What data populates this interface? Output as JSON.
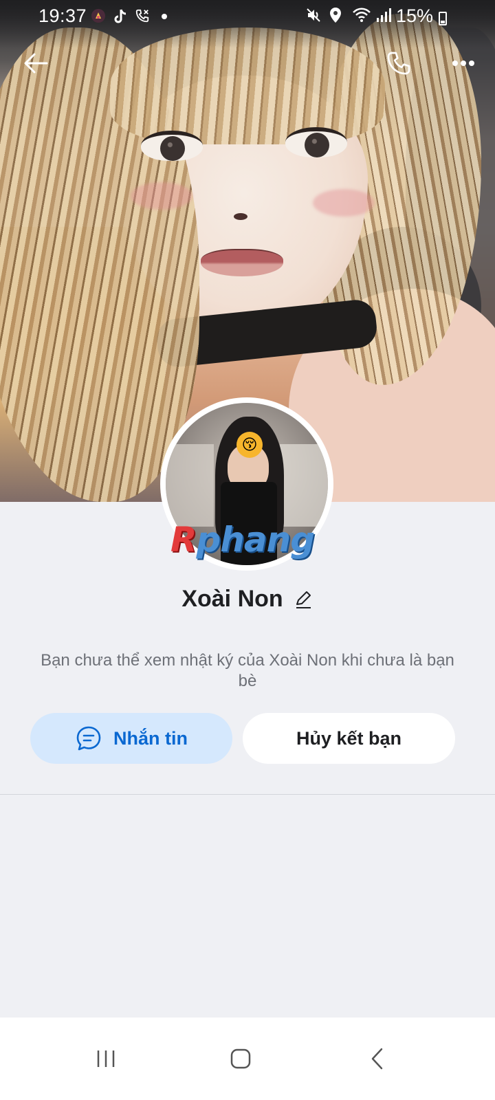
{
  "status_bar": {
    "time": "19:37",
    "battery": "15%",
    "icons_left": [
      "app-notification-icon",
      "tiktok-icon",
      "phone-call-icon",
      "dot-icon"
    ],
    "icons_right": [
      "mute-icon",
      "location-icon",
      "wifi-icon",
      "signal-icon"
    ]
  },
  "header": {
    "back_icon": "arrow-left-icon",
    "call_icon": "phone-icon",
    "more_icon": "more-horizontal-icon"
  },
  "watermark": {
    "first_letter": "R",
    "rest": "phang"
  },
  "profile": {
    "name": "Xoài Non",
    "edit_icon": "pencil-icon",
    "description": "Bạn chưa thể xem nhật ký của Xoài Non khi chưa là bạn bè"
  },
  "actions": {
    "message_label": "Nhắn tin",
    "unfriend_label": "Hủy kết bạn"
  },
  "colors": {
    "accent": "#0a68d1",
    "message_button_bg": "#d5e8fd",
    "page_bg": "#eff0f4"
  },
  "bottom_nav": [
    "recent-apps-icon",
    "home-icon",
    "back-icon"
  ]
}
